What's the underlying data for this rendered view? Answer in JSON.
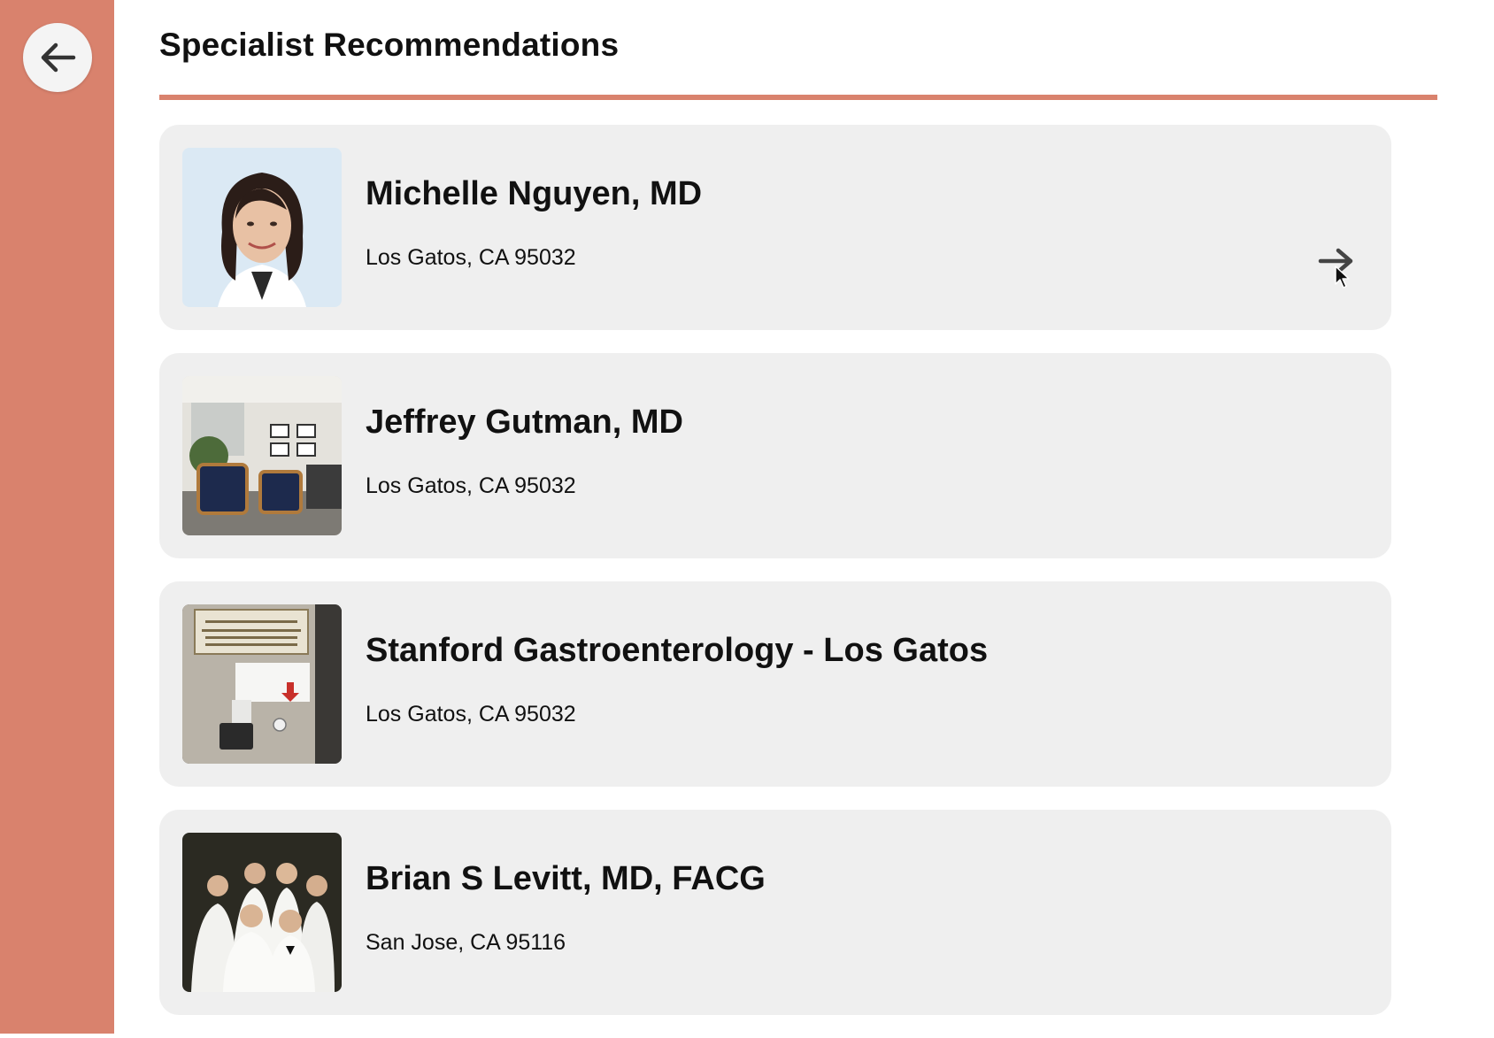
{
  "header": {
    "title": "Specialist Recommendations",
    "back_icon": "arrow-left-icon"
  },
  "colors": {
    "accent": "#d9826d",
    "card_bg": "#efefef"
  },
  "specialists": [
    {
      "name": "Michelle Nguyen, MD",
      "address": "Los Gatos, CA 95032",
      "photo": "portrait-photo",
      "arrow_icon": "arrow-right-icon"
    },
    {
      "name": "Jeffrey Gutman, MD",
      "address": "Los Gatos, CA 95032",
      "photo": "office-waiting-room-photo"
    },
    {
      "name": "Stanford Gastroenterology - Los Gatos",
      "address": "Los Gatos, CA 95032",
      "photo": "clinic-door-sign-photo"
    },
    {
      "name": "Brian S Levitt, MD, FACG",
      "address": "San Jose, CA 95116",
      "photo": "group-of-doctors-photo"
    }
  ]
}
